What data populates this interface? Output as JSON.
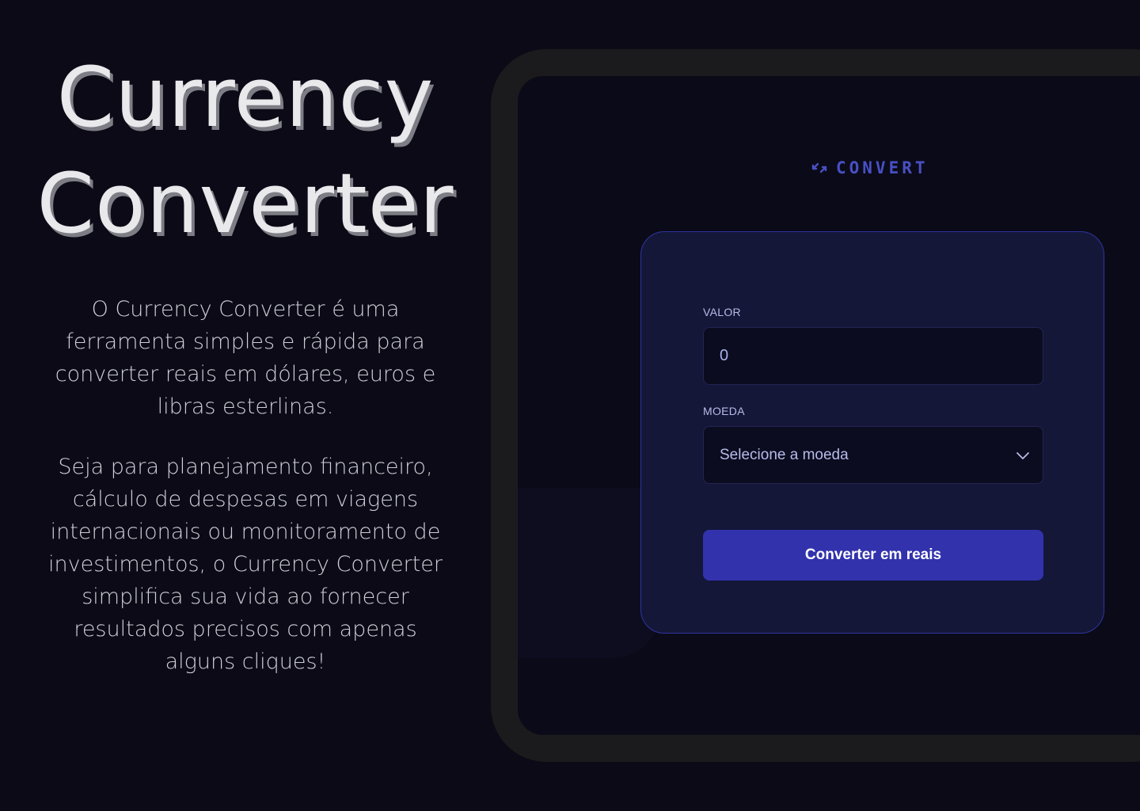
{
  "hero": {
    "title_line1": "Currency",
    "title_line2": "Converter",
    "paragraph1": "O Currency Converter é uma ferramenta simples e rápida para converter reais em dólares, euros e libras esterlinas.",
    "paragraph2": "Seja para planejamento financeiro, cálculo de despesas em viagens internacionais ou monitoramento de investimentos, o Currency Converter simplifica sua vida ao fornecer resultados precisos com apenas alguns cliques!"
  },
  "app": {
    "logo_text": "CONVERT",
    "logo_icon": "exchange-arrows-icon",
    "form": {
      "valor_label": "VALOR",
      "valor_value": "0",
      "moeda_label": "MOEDA",
      "moeda_selected": "Selecione a moeda",
      "submit_label": "Converter em reais"
    }
  },
  "colors": {
    "background": "#0b0a16",
    "accent": "#3232ad",
    "logo": "#4850c4",
    "card": "#141738",
    "card_border": "#2f34a0"
  }
}
